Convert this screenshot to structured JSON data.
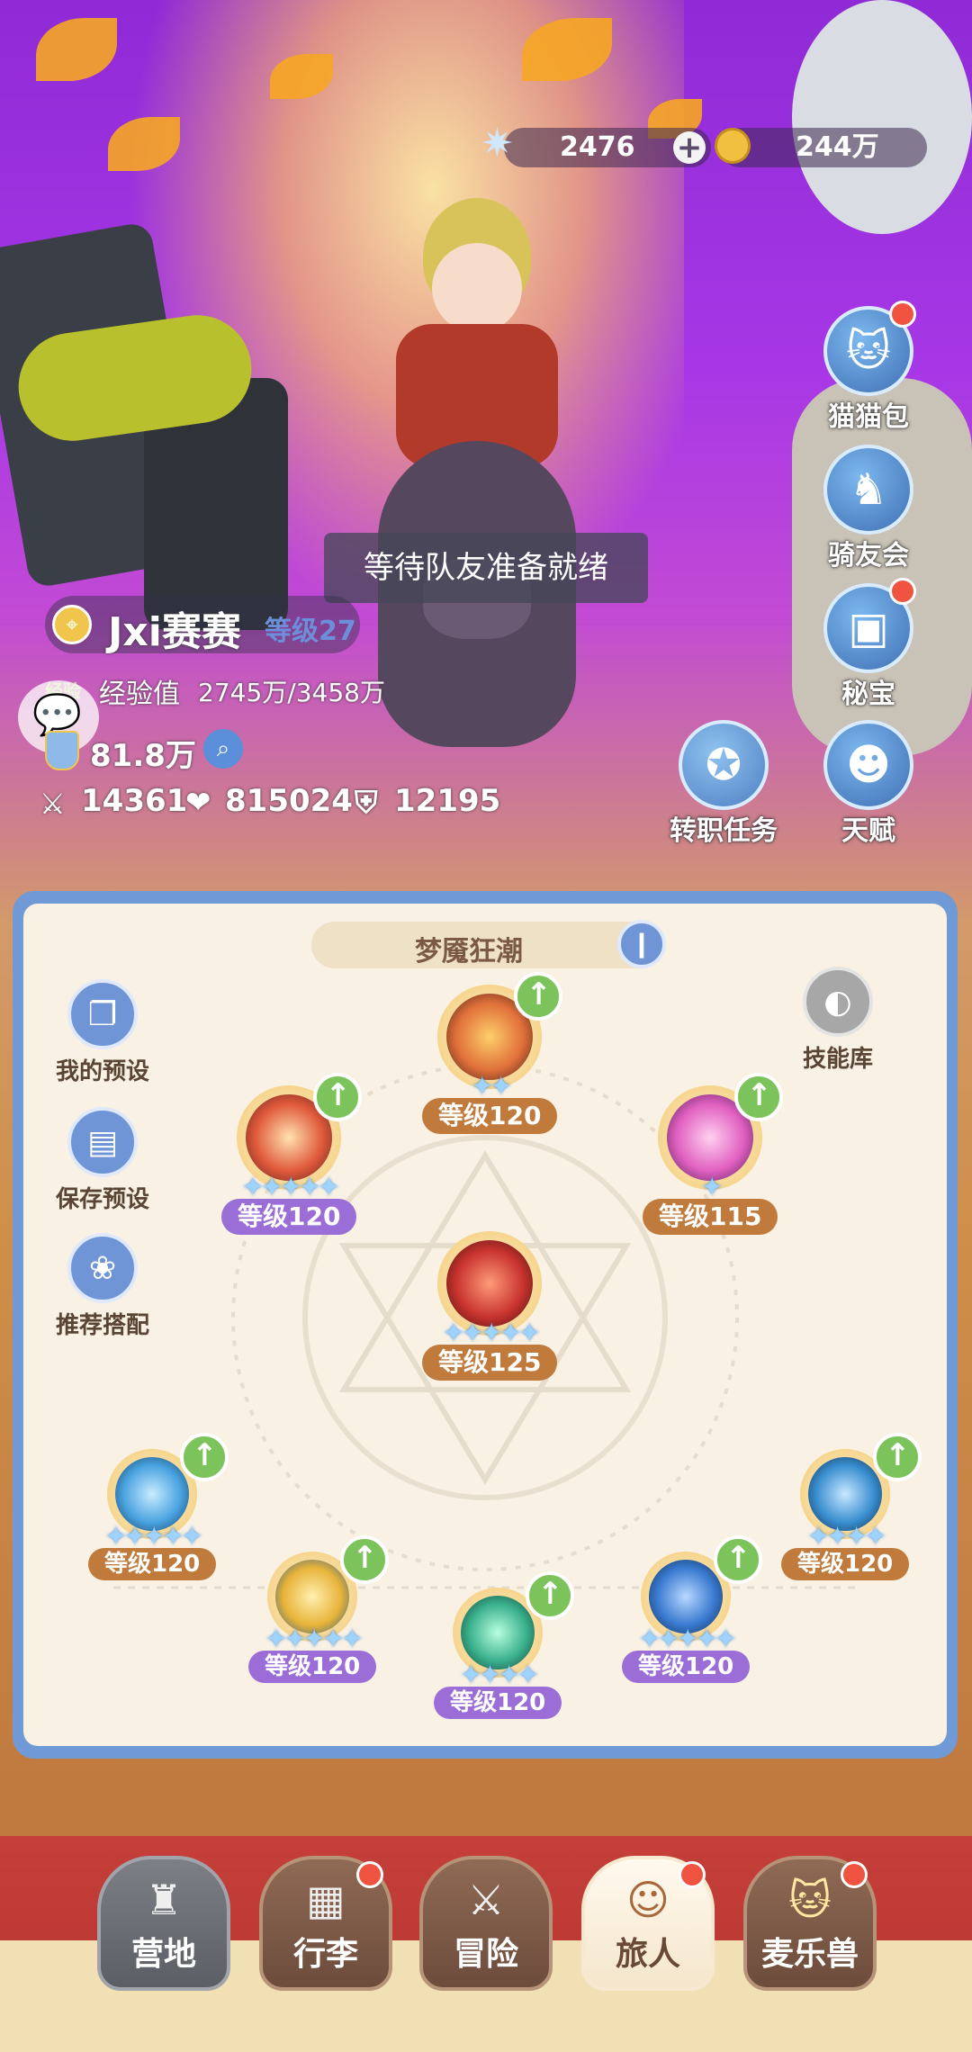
{
  "currency": {
    "gems": "2476",
    "plus_label": "+",
    "gold": "244万"
  },
  "toast": "等待队友准备就绪",
  "player": {
    "name": "Jxi赛赛",
    "level": "等级27",
    "exp_tag": "经验",
    "exp_label": "经验值",
    "exp_value": "2745万/3458万",
    "power": "81.8万",
    "attack": "14361",
    "hp": "815024",
    "defense": "12195"
  },
  "side_buttons": [
    {
      "label": "猫猫包",
      "icon": "cat-bag-icon",
      "badge": true
    },
    {
      "label": "骑友会",
      "icon": "horse-icon",
      "badge": false
    },
    {
      "label": "秘宝",
      "icon": "treasure-chest-icon",
      "badge": true
    },
    {
      "label": "天赋",
      "icon": "talent-head-icon",
      "badge": false
    }
  ],
  "job_quest_label": "转职任务",
  "panel": {
    "title": "梦魇狂潮",
    "left_tools": [
      {
        "label": "我的预设",
        "icon": "preset-icon"
      },
      {
        "label": "保存预设",
        "icon": "save-icon"
      },
      {
        "label": "推荐搭配",
        "icon": "recommend-icon"
      }
    ],
    "skill_library_label": "技能库"
  },
  "skills": [
    {
      "id": "top",
      "level": "等级120",
      "stars": "✦✦",
      "style": "brown",
      "color": "#e0703a",
      "upgrade": true
    },
    {
      "id": "left",
      "level": "等级120",
      "stars": "✦✦✦✦✦",
      "style": "purple",
      "color": "#e05a3c",
      "upgrade": true
    },
    {
      "id": "right",
      "level": "等级115",
      "stars": "✦",
      "style": "brown",
      "color": "#e060c0",
      "upgrade": true
    },
    {
      "id": "center",
      "level": "等级125",
      "stars": "✦✦✦✦✦",
      "style": "brown",
      "color": "#c8332e",
      "upgrade": false
    },
    {
      "id": "b1",
      "level": "等级120",
      "stars": "✦✦✦✦✦",
      "style": "brown",
      "color": "#4aa3e0",
      "upgrade": true
    },
    {
      "id": "b2",
      "level": "等级120",
      "stars": "✦✦✦✦✦",
      "style": "purple",
      "color": "#e8b43a",
      "upgrade": true
    },
    {
      "id": "b3",
      "level": "等级120",
      "stars": "✦✦✦✦",
      "style": "purple",
      "color": "#3ab08c",
      "upgrade": true
    },
    {
      "id": "b4",
      "level": "等级120",
      "stars": "✦✦✦✦✦",
      "style": "purple",
      "color": "#3a7ad0",
      "upgrade": true
    },
    {
      "id": "b5",
      "level": "等级120",
      "stars": "✦✦✦✦",
      "style": "brown",
      "color": "#3a8fd0",
      "upgrade": true
    }
  ],
  "tabs": [
    {
      "label": "营地",
      "icon": "castle-icon",
      "badge": false,
      "active": false
    },
    {
      "label": "行李",
      "icon": "chest-icon",
      "badge": true,
      "active": false
    },
    {
      "label": "冒险",
      "icon": "crossed-swords-icon",
      "badge": false,
      "active": false
    },
    {
      "label": "旅人",
      "icon": "traveler-icon",
      "badge": true,
      "active": true
    },
    {
      "label": "麦乐兽",
      "icon": "cat-pet-icon",
      "badge": true,
      "active": false
    }
  ]
}
